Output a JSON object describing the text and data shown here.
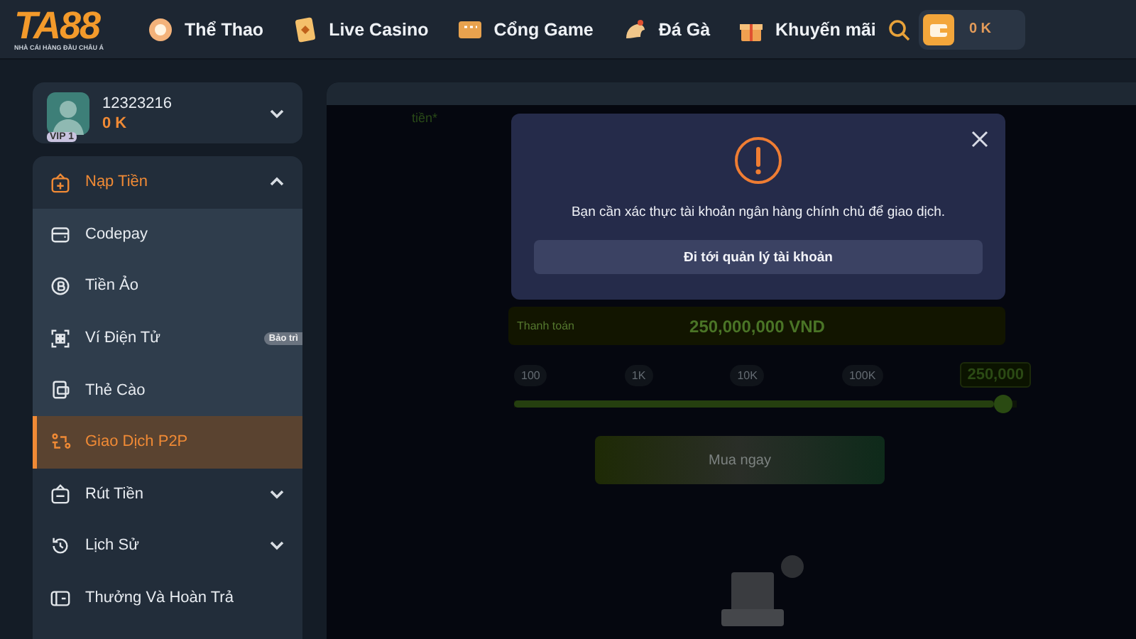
{
  "header": {
    "logo": {
      "text": "TA88",
      "tagline": "NHÀ CÁI HÀNG ĐẦU CHÂU Á"
    },
    "nav": [
      {
        "label": "Thể Thao"
      },
      {
        "label": "Live Casino"
      },
      {
        "label": "Cổng Game"
      },
      {
        "label": "Đá Gà"
      },
      {
        "label": "Khuyến mãi"
      }
    ],
    "wallet": "0 K"
  },
  "profile": {
    "username": "12323216",
    "balance": "0 K",
    "vip": "VIP 1"
  },
  "menu": [
    {
      "label": "Nạp Tiền",
      "kind": "group",
      "expanded": true,
      "children": [
        {
          "label": "Codepay",
          "selected": false
        },
        {
          "label": "Tiền Ảo",
          "selected": false
        },
        {
          "label": "Ví Điện Tử",
          "selected": false,
          "badge": "Bảo trì"
        },
        {
          "label": "Thẻ Cào",
          "selected": false
        },
        {
          "label": "Giao Dịch P2P",
          "selected": true
        }
      ]
    },
    {
      "label": "Rút Tiền",
      "kind": "group",
      "expanded": false
    },
    {
      "label": "Lịch Sử",
      "kind": "group",
      "expanded": false
    },
    {
      "label": "Thưởng Và Hoàn Trả",
      "kind": "link"
    }
  ],
  "form": {
    "label_fragment": "tiền*",
    "payment": {
      "label": "Thanh toán",
      "value": "250,000,000 VND"
    },
    "ticks": [
      "100",
      "1K",
      "10K",
      "100K"
    ],
    "amount": "250,000",
    "slider": {
      "level": 0.99
    },
    "buy_button": "Mua ngay"
  },
  "modal": {
    "message": "Bạn cần xác thực tài khoản ngân hàng chính chủ để giao dịch.",
    "action": "Đi tới quản lý tài khoản"
  }
}
